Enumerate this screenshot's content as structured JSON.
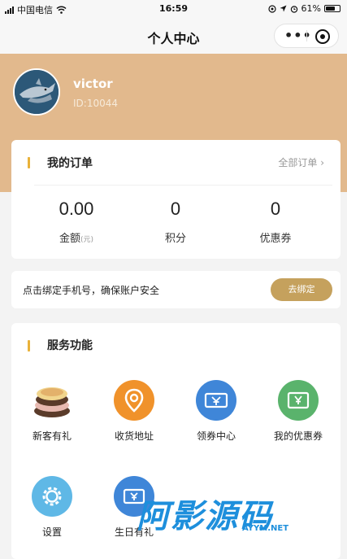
{
  "status_bar": {
    "carrier": "中国电信",
    "time": "16:59",
    "battery": "61%"
  },
  "nav": {
    "title": "个人中心",
    "more_icon": "more-dots-icon",
    "close_icon": "mini-program-close-icon"
  },
  "profile": {
    "name": "victor",
    "id": "ID:10044"
  },
  "orders": {
    "title": "我的订单",
    "all_link": "全部订单 ›",
    "stats": [
      {
        "value": "0.00",
        "label": "金额",
        "unit": "(元)"
      },
      {
        "value": "0",
        "label": "积分"
      },
      {
        "value": "0",
        "label": "优惠券"
      }
    ]
  },
  "bind_phone": {
    "text": "点击绑定手机号，确保账户安全",
    "button": "去绑定"
  },
  "services": {
    "title": "服务功能",
    "items": [
      {
        "label": "新客有礼",
        "icon": "gift-cake-icon",
        "color": "#c9a87a"
      },
      {
        "label": "收货地址",
        "icon": "location-pin-icon",
        "color": "#f0922b"
      },
      {
        "label": "领券中心",
        "icon": "coupon-ticket-icon",
        "color": "#3f86d8"
      },
      {
        "label": "我的优惠券",
        "icon": "coupon-wallet-icon",
        "color": "#5ab36c"
      },
      {
        "label": "设置",
        "icon": "gear-icon",
        "color": "#5fb8e6"
      },
      {
        "label": "生日有礼",
        "icon": "birthday-gift-icon",
        "color": "#3f86d8"
      }
    ]
  },
  "watermark": {
    "main": "阿影源码",
    "sub": "AYYM.NET"
  },
  "colors": {
    "header": "#e2b98d",
    "accent_bar": "#e9b23a",
    "bind_button": "#c5a15d"
  }
}
